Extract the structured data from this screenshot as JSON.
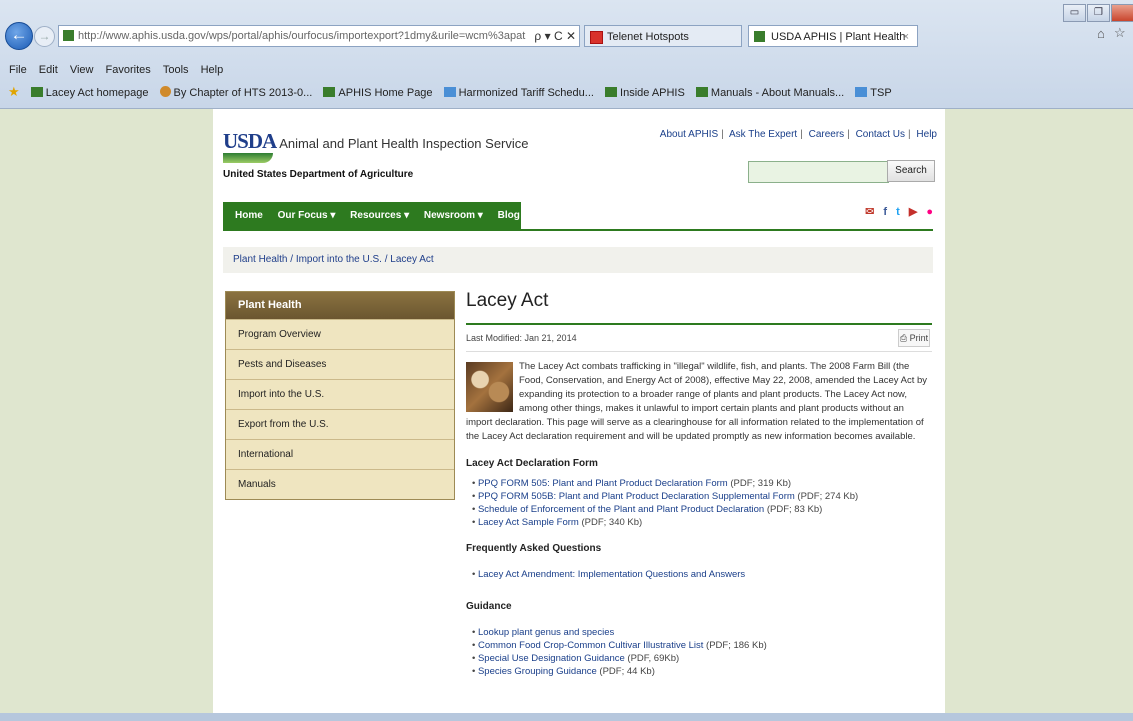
{
  "browser": {
    "address": "http://www.aphis.usda.gov/wps/portal/aphis/ourfocus/importexport?1dmy&urile=wcm%3apat",
    "address_ctrl": "ρ ▾ C ✕",
    "tabs": [
      {
        "label": "Telenet Hotspots"
      },
      {
        "label": "USDA APHIS | Plant Health"
      }
    ],
    "tab_close": "×",
    "menu": [
      "File",
      "Edit",
      "View",
      "Favorites",
      "Tools",
      "Help"
    ],
    "favorites": [
      "Lacey Act homepage",
      "By Chapter of HTS 2013-0...",
      "APHIS Home Page",
      "Harmonized Tariff Schedu...",
      "Inside APHIS",
      "Manuals - About Manuals...",
      "TSP"
    ]
  },
  "header": {
    "logo_text": "USDA",
    "agency": "Animal and Plant Health Inspection Service",
    "department": "United States Department of Agriculture",
    "top_links": [
      "About APHIS",
      "Ask The Expert",
      "Careers",
      "Contact Us",
      "Help"
    ],
    "search_button": "Search",
    "search_placeholder": ""
  },
  "nav": [
    "Home",
    "Our Focus ▾",
    "Resources ▾",
    "Newsroom ▾",
    "Blog"
  ],
  "breadcrumb": "Plant Health  /  Import into the U.S.  /  Lacey Act",
  "sidebar": {
    "title": "Plant Health",
    "items": [
      "Program Overview",
      "Pests and Diseases",
      "Import into the U.S.",
      "Export from the U.S.",
      "International",
      "Manuals"
    ]
  },
  "article": {
    "title": "Lacey Act",
    "last_modified": "Last Modified: Jan 21, 2014",
    "print": "Print",
    "intro": "The Lacey Act combats trafficking in \"illegal\" wildlife, fish, and plants. The 2008 Farm Bill (the Food, Conservation, and Energy Act of 2008), effective May 22, 2008, amended the Lacey Act by expanding its protection to a broader range of plants and plant products. The Lacey Act now, among other things, makes it unlawful to import certain plants and plant products without an import declaration. This page will serve as a clearinghouse for all information related to the implementation of the Lacey Act declaration requirement and will be updated promptly as new information becomes available.",
    "sections": [
      {
        "heading": "Lacey Act Declaration Form",
        "items": [
          {
            "link": "PPQ FORM 505: Plant and Plant Product Declaration Form",
            "suffix": " (PDF; 319 Kb)"
          },
          {
            "link": "PPQ FORM 505B: Plant and Plant Product Declaration Supplemental Form",
            "suffix": " (PDF; 274 Kb)"
          },
          {
            "link": "Schedule of Enforcement of the Plant and Plant Product Declaration",
            "suffix": " (PDF; 83 Kb)"
          },
          {
            "link": "Lacey Act Sample Form",
            "suffix": " (PDF; 340 Kb)"
          }
        ]
      },
      {
        "heading": "Frequently Asked Questions",
        "items": [
          {
            "link": "Lacey Act Amendment: Implementation Questions and Answers",
            "suffix": ""
          }
        ]
      },
      {
        "heading": "Guidance",
        "items": [
          {
            "link": "Lookup plant genus and species",
            "suffix": ""
          },
          {
            "link": "Common Food Crop-Common Cultivar Illustrative List",
            "suffix": " (PDF; 186 Kb)"
          },
          {
            "link": "Special Use Designation Guidance",
            "suffix": " (PDF, 69Kb)"
          },
          {
            "link": "Species Grouping Guidance",
            "suffix": " (PDF; 44 Kb)"
          }
        ]
      }
    ]
  }
}
